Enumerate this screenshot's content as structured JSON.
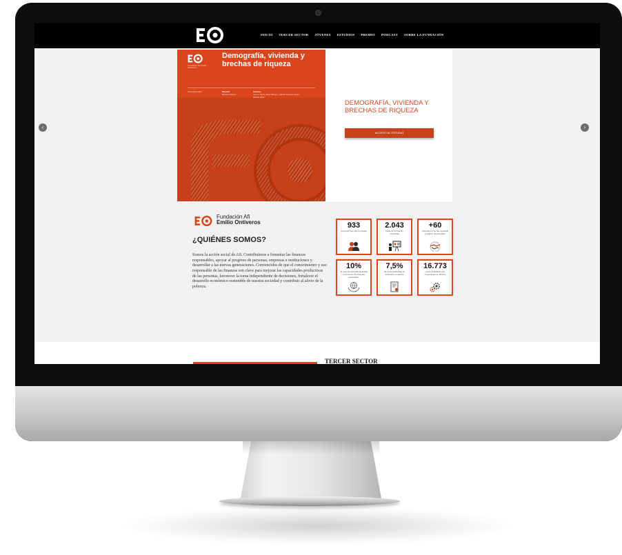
{
  "brand": {
    "logo_text": "EO",
    "name_line1": "Fundación Afi",
    "name_line2": "Emilio Ontiveros",
    "accent_color": "#d9461d"
  },
  "nav": {
    "items": [
      "INICIO",
      "TERCER SECTOR",
      "JÓVENES",
      "ESTUDIOS",
      "PREMIO",
      "PODCAST",
      "SOBRE LA FUNDACIÓN"
    ]
  },
  "slider": {
    "prev_icon": "chevron-left-icon",
    "next_icon": "chevron-right-icon",
    "image": {
      "title": "Demografía, vivienda y brechas de riqueza",
      "logo_caption": "Fundación Afi Emilio Ontiveros",
      "date": "Noviembre 2024",
      "director_label": "Director",
      "director": "Ricardo Iceluren",
      "authors_label": "Autores",
      "authors": "José A. Herce, Angel Berges, Yolanda Jiménez Lucas, Manuel Rollé"
    },
    "title": "DEMOGRAFÍA, VIVIENDA Y BRECHAS DE RIQUEZA",
    "cta": "ACCESO AL ESTUDIO"
  },
  "about": {
    "heading": "¿QUIÉNES SOMOS?",
    "body": "Somos la acción social de Afi. Contribuimos a fomentar las finanzas responsables, apoyar al progreso de personas, empresas e instituciones y desarrollar a las nuevas generaciones. Convencidos de que el conocimiento y uso responsable de las finanzas son clave para mejorar las capacidades productivas de las personas, favorecer la toma independiente de decisiones, fortalecer el desarrollo económico sostenible de nuestra sociedad y contribuir al alivio de la pobreza."
  },
  "stats": [
    {
      "value": "933",
      "label": "personas han sido formadas",
      "icon": "people-icon"
    },
    {
      "value": "2.043",
      "label": "horas de formación impartidas",
      "icon": "presentation-icon"
    },
    {
      "value": "+60",
      "label": "voluntarios nos han ayudado a realizar nuestra labor",
      "icon": "handshake-icon"
    },
    {
      "value": "10%",
      "label": "de nuestra actividad dedicada a promover las finanzas sostenibles",
      "icon": "globe-hands-icon"
    },
    {
      "value": "7,5%",
      "label": "de horas dedicadas en exclusiva a mujeres",
      "icon": "certificate-icon"
    },
    {
      "value": "16.773",
      "label": "euros dedicados a la cooperación en México",
      "icon": "gears-icon"
    }
  ],
  "next_section": {
    "heading": "TERCER SECTOR"
  }
}
